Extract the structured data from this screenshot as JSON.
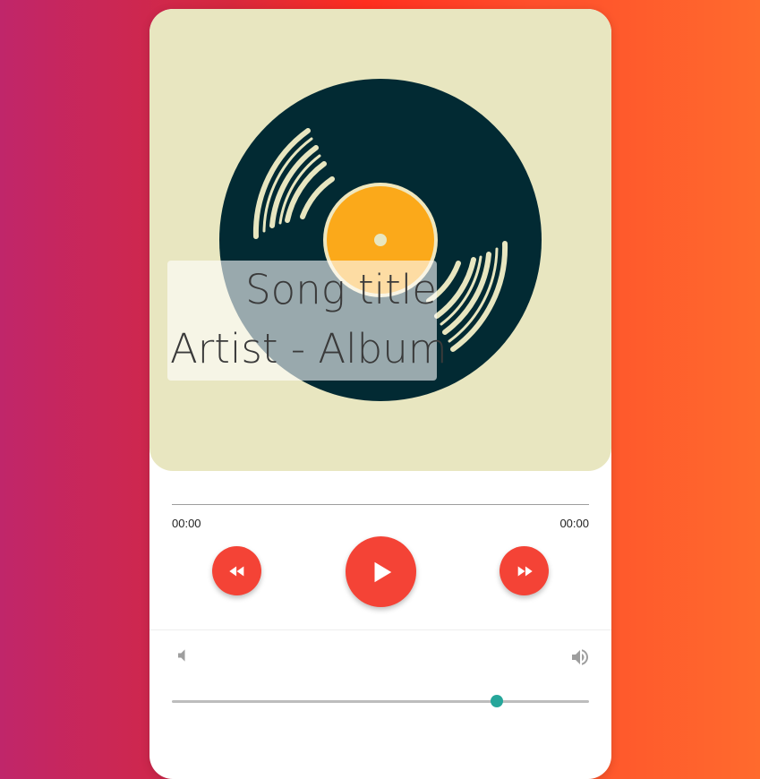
{
  "track": {
    "title": "Song title",
    "artist_album": "Artist - Album"
  },
  "progress": {
    "current_time": "00:00",
    "duration": "00:00",
    "fraction": 0
  },
  "controls": {
    "rewind_icon": "fast-rewind-icon",
    "play_icon": "play-icon",
    "forward_icon": "fast-forward-icon"
  },
  "volume": {
    "low_icon": "volume-low-icon",
    "high_icon": "volume-high-icon",
    "level": 0.78
  },
  "colors": {
    "accent": "#f44336",
    "volume_thumb": "#26a69a",
    "artwork_background": "#e8e6c0"
  }
}
